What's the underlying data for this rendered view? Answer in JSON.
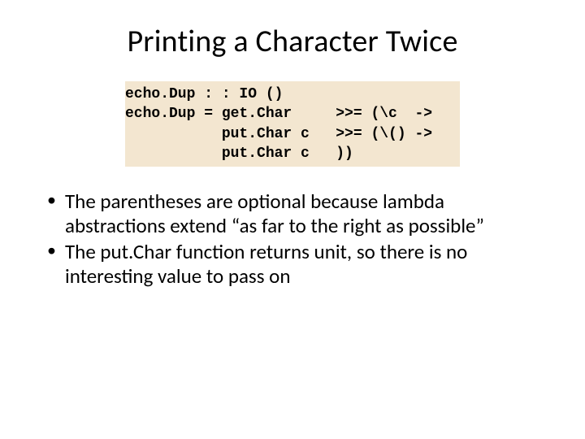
{
  "title": "Printing a Character Twice",
  "code": "echo.Dup : : IO ()\necho.Dup = get.Char     >>= (\\c  ->\n           put.Char c   >>= (\\() ->\n           put.Char c   ))",
  "bullets": [
    "The parentheses are optional because lambda abstractions extend “as far to the right as possible”",
    "The put.Char function returns unit, so there is no interesting value to pass on"
  ]
}
